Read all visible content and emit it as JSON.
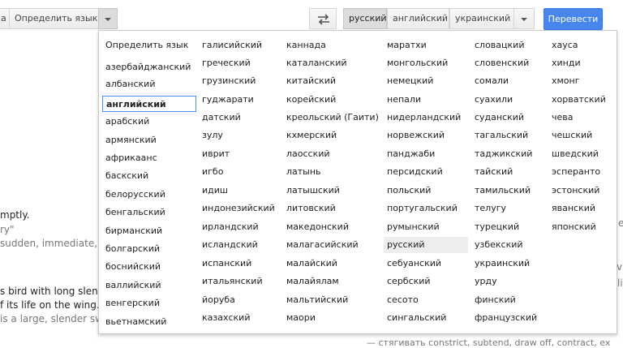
{
  "toolbar": {
    "source_detected": "а",
    "detect_language_label": "Определить язык",
    "target_languages": [
      "русский",
      "английский",
      "украинский"
    ],
    "translate_label": "Перевести"
  },
  "background": {
    "lines": [
      "mptly.",
      "ry\"",
      "sudden, immediate,",
      "s bird with long slende",
      "f its life on the wing.",
      "is a large, slender sw"
    ],
    "right_glyphs": [
      "e",
      "vi",
      "li"
    ],
    "bottom_line": "— стягивать    constrict, subtend, draw off, contract, ex"
  },
  "dropdown": {
    "columns": [
      [
        "Определить язык",
        "азербайджанский",
        "албанский",
        "английский",
        "арабский",
        "армянский",
        "африкаанс",
        "баскский",
        "белорусский",
        "бенгальский",
        "бирманский",
        "болгарский",
        "боснийский",
        "валлийский",
        "венгерский",
        "вьетнамский"
      ],
      [
        "галисийский",
        "греческий",
        "грузинский",
        "гуджарати",
        "датский",
        "зулу",
        "иврит",
        "игбо",
        "идиш",
        "индонезийский",
        "ирландский",
        "исландский",
        "испанский",
        "итальянский",
        "йоруба",
        "казахский"
      ],
      [
        "каннада",
        "каталанский",
        "китайский",
        "корейский",
        "креольский (Гаити)",
        "кхмерский",
        "лаосский",
        "латынь",
        "латышский",
        "литовский",
        "македонский",
        "малагасийский",
        "малайский",
        "малайялам",
        "мальтийский",
        "маори"
      ],
      [
        "маратхи",
        "монгольский",
        "немецкий",
        "непали",
        "нидерландский",
        "норвежский",
        "панджаби",
        "персидский",
        "польский",
        "португальский",
        "румынский",
        "русский",
        "себуанский",
        "сербский",
        "сесото",
        "сингальский"
      ],
      [
        "словацкий",
        "словенский",
        "сомали",
        "суахили",
        "суданский",
        "тагальский",
        "таджикский",
        "тайский",
        "тамильский",
        "телугу",
        "турецкий",
        "узбекский",
        "украинский",
        "урду",
        "финский",
        "французский"
      ],
      [
        "хауса",
        "хинди",
        "хмонг",
        "хорватский",
        "чева",
        "чешский",
        "шведский",
        "эсперанто",
        "эстонский",
        "яванский",
        "японский"
      ]
    ]
  }
}
